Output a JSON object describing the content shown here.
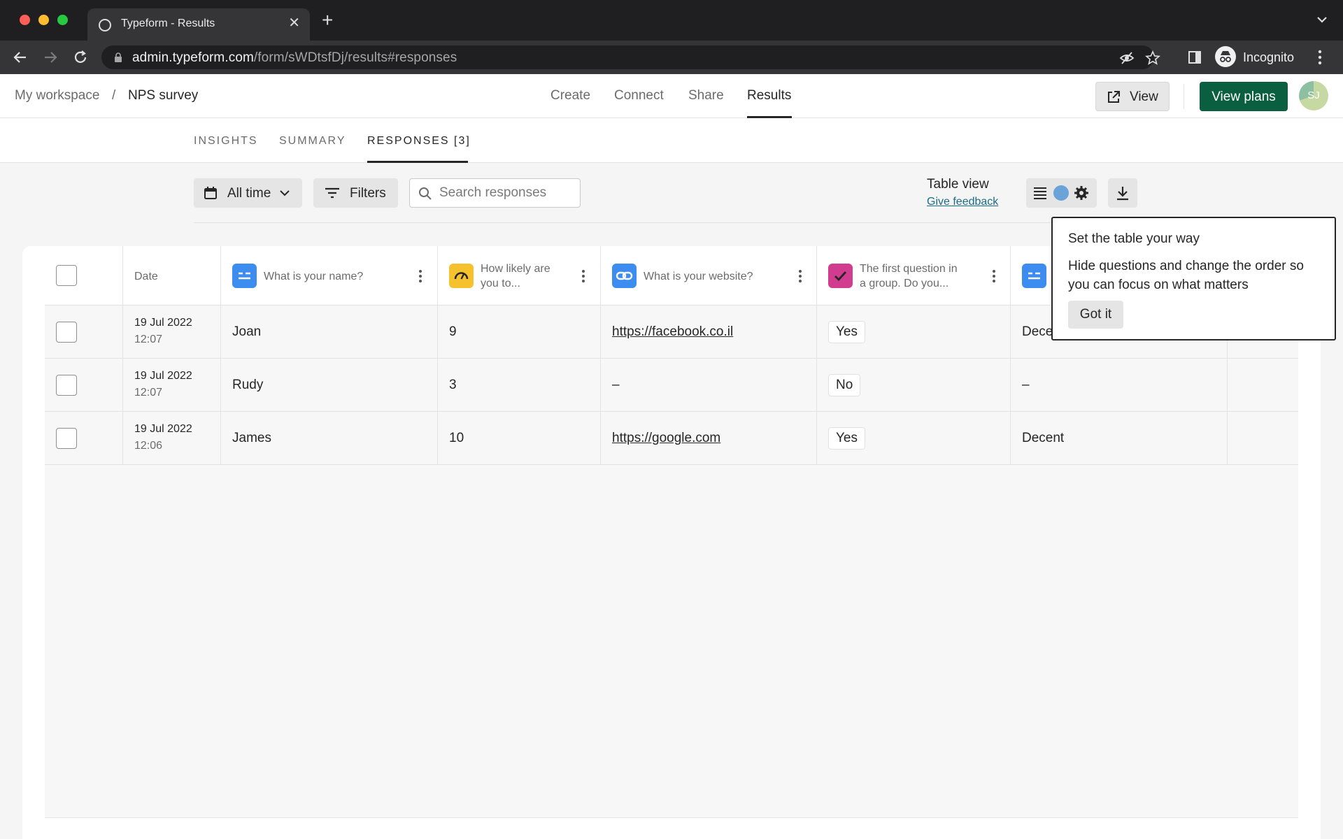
{
  "browser": {
    "tab_title": "Typeform - Results",
    "url_host": "admin.typeform.com",
    "url_path": "/form/sWDtsfDj/results#responses",
    "profile_label": "Incognito"
  },
  "header": {
    "workspace": "My workspace",
    "separator": "/",
    "form_name": "NPS survey",
    "nav": [
      "Create",
      "Connect",
      "Share",
      "Results"
    ],
    "active_nav": "Results",
    "view_button": "View",
    "plans_button": "View plans",
    "avatar_initials": "SJ"
  },
  "subtabs": {
    "insights": "INSIGHTS",
    "summary": "SUMMARY",
    "responses": "RESPONSES [3]"
  },
  "toolbar": {
    "time_filter": "All time",
    "filters": "Filters",
    "search_placeholder": "Search responses",
    "table_view_label": "Table view",
    "feedback_link": "Give feedback"
  },
  "table": {
    "columns": [
      {
        "label": "Date"
      },
      {
        "label": "What is your name?",
        "icon": "short-text-icon",
        "icon_color": "#3d8cf0"
      },
      {
        "label_line1": "How likely are",
        "label_line2": "you to...",
        "icon": "opinion-scale-icon",
        "icon_color": "#f5c22e"
      },
      {
        "label": "What is your website?",
        "icon": "link-icon",
        "icon_color": "#3d8cf0"
      },
      {
        "label_line1": "The first question in",
        "label_line2": "a group. Do you...",
        "icon": "yes-no-icon",
        "icon_color": "#d13c8f"
      }
    ],
    "rows": [
      {
        "date": "19 Jul 2022",
        "time": "12:07",
        "name": "Joan",
        "score": "9",
        "website": "https://facebook.co.il",
        "answer": "Yes",
        "extra": "Dece"
      },
      {
        "date": "19 Jul 2022",
        "time": "12:07",
        "name": "Rudy",
        "score": "3",
        "website": "–",
        "answer": "No",
        "extra": "–"
      },
      {
        "date": "19 Jul 2022",
        "time": "12:06",
        "name": "James",
        "score": "10",
        "website": "https://google.com",
        "answer": "Yes",
        "extra": "Decent"
      }
    ]
  },
  "tooltip": {
    "title": "Set the table your way",
    "body": "Hide questions and change the order so you can focus on what matters",
    "button": "Got it"
  },
  "colors": {
    "accent_green": "#0b5f41",
    "link_blue": "#1b6d85"
  }
}
